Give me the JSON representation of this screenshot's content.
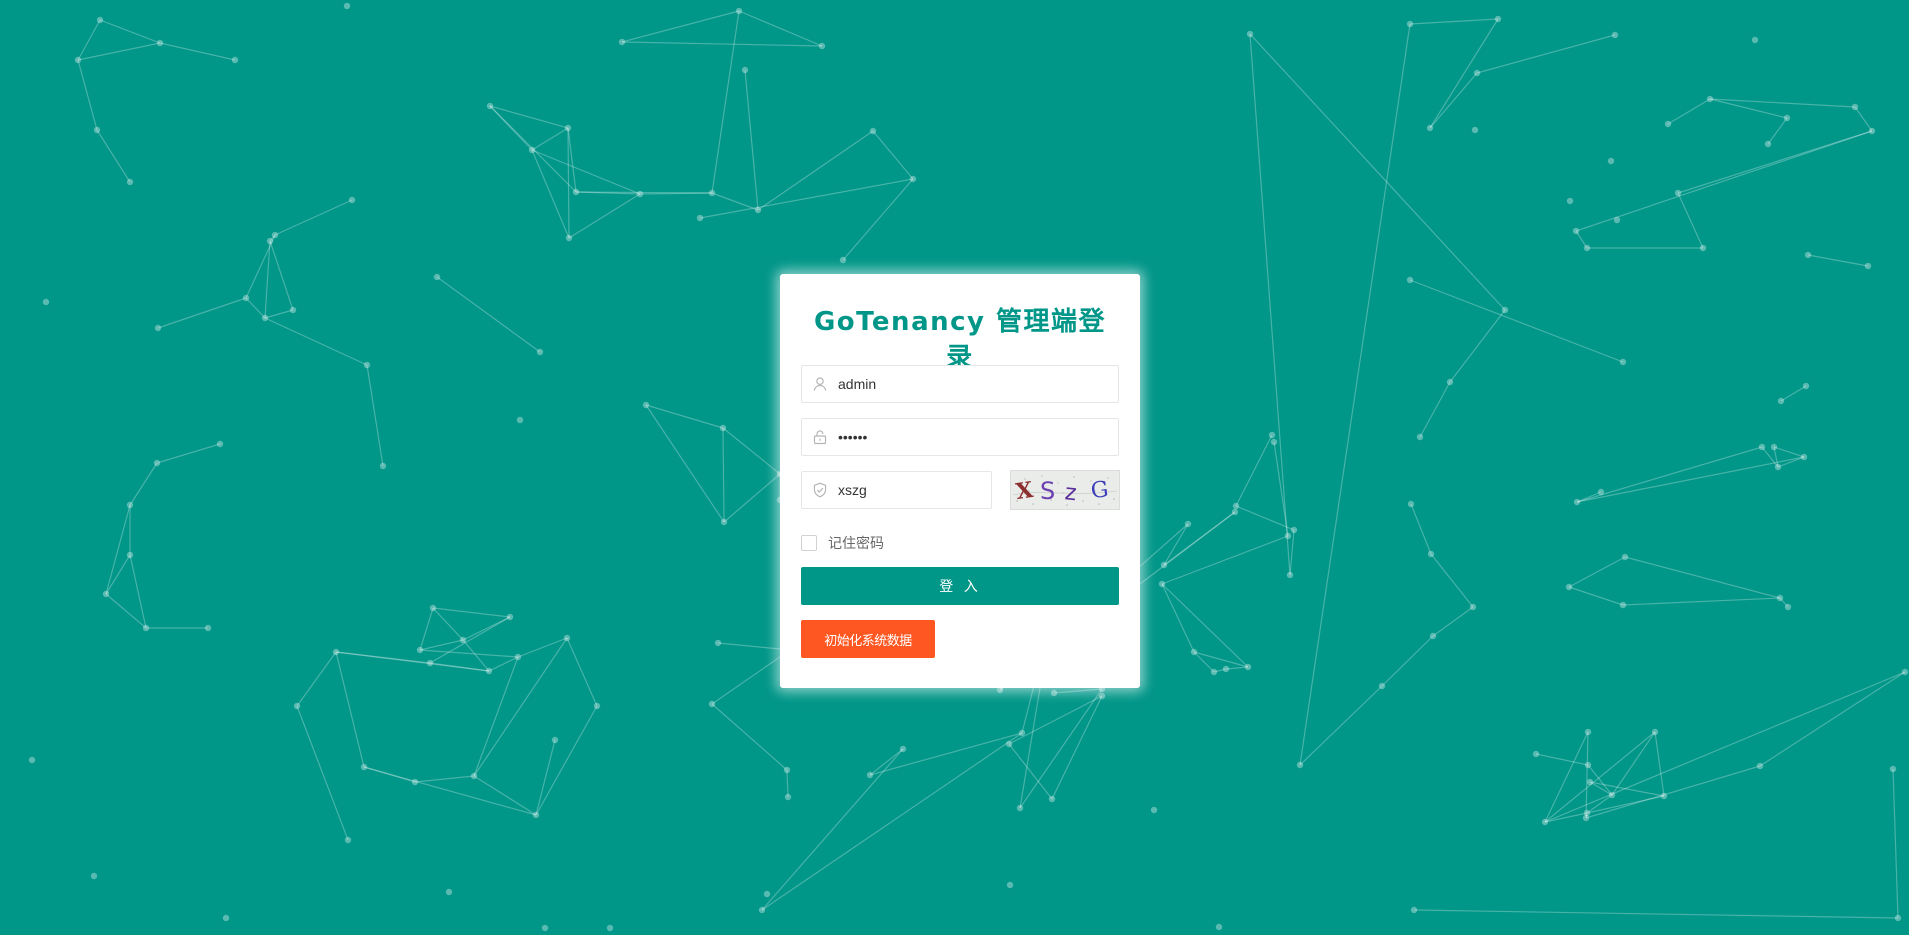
{
  "page": {
    "title": "GoTenancy 管理端登录"
  },
  "form": {
    "username": {
      "value": "admin",
      "icon": "user-icon"
    },
    "password": {
      "value": "123456",
      "icon": "lock-icon"
    },
    "captcha": {
      "value": "xszg",
      "icon": "shield-icon",
      "image_text": "XSzG"
    },
    "remember": {
      "label": "记住密码",
      "checked": false
    },
    "login_button": "登 入",
    "init_button": "初始化系统数据"
  },
  "colors": {
    "background": "#009688",
    "accent": "#009688",
    "warning_button": "#ff5722",
    "card": "#ffffff"
  }
}
